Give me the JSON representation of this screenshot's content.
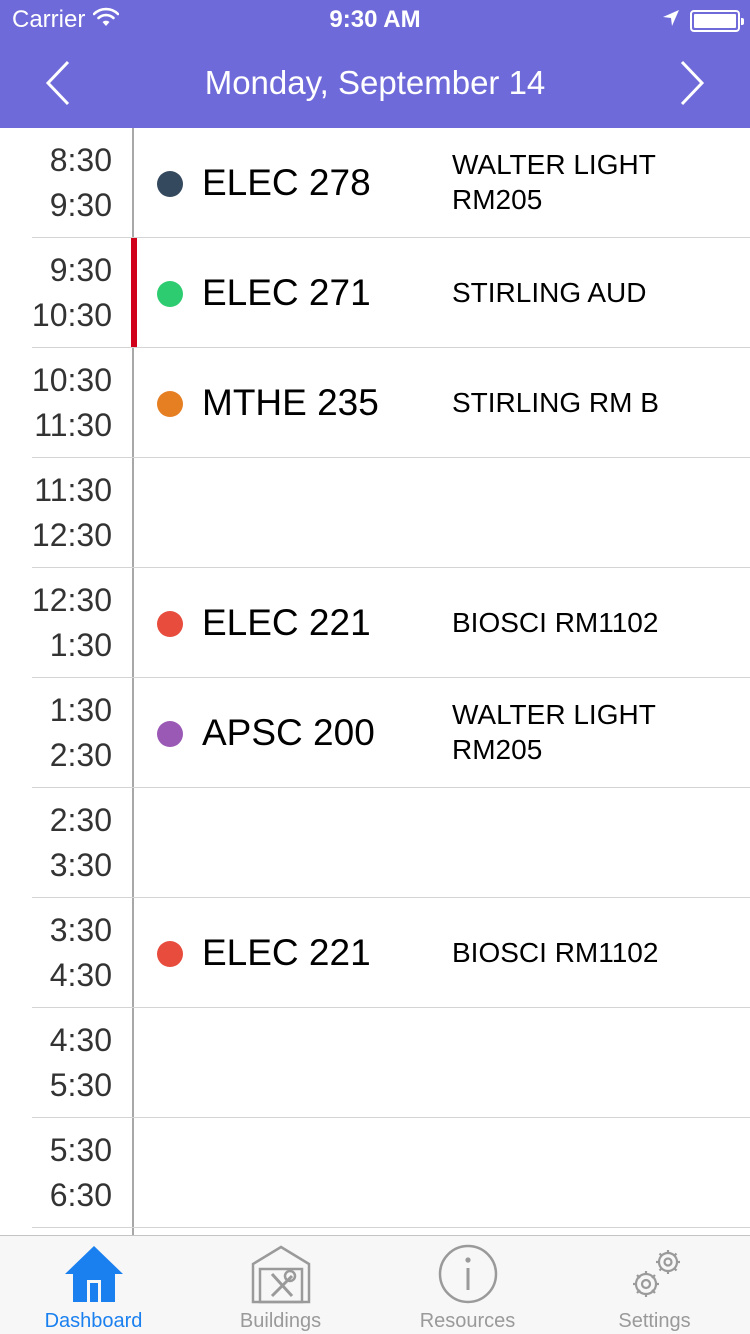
{
  "status_bar": {
    "carrier": "Carrier",
    "time": "9:30 AM"
  },
  "nav": {
    "title": "Monday, September 14",
    "prev_icon": "chevron-left-icon",
    "next_icon": "chevron-right-icon"
  },
  "schedule": {
    "current_slot": 1,
    "slots": [
      {
        "start": "8:30",
        "end": "9:30",
        "course": "ELEC 278",
        "room": "WALTER LIGHT RM205",
        "color": "#34495e"
      },
      {
        "start": "9:30",
        "end": "10:30",
        "course": "ELEC 271",
        "room": "STIRLING AUD",
        "color": "#2ecc71"
      },
      {
        "start": "10:30",
        "end": "11:30",
        "course": "MTHE 235",
        "room": "STIRLING RM B",
        "color": "#e67e22"
      },
      {
        "start": "11:30",
        "end": "12:30",
        "course": "",
        "room": "",
        "color": ""
      },
      {
        "start": "12:30",
        "end": "1:30",
        "course": "ELEC 221",
        "room": "BIOSCI RM1102",
        "color": "#e74c3c"
      },
      {
        "start": "1:30",
        "end": "2:30",
        "course": "APSC 200",
        "room": "WALTER LIGHT RM205",
        "color": "#9b59b6"
      },
      {
        "start": "2:30",
        "end": "3:30",
        "course": "",
        "room": "",
        "color": ""
      },
      {
        "start": "3:30",
        "end": "4:30",
        "course": "ELEC 221",
        "room": "BIOSCI RM1102",
        "color": "#e74c3c"
      },
      {
        "start": "4:30",
        "end": "5:30",
        "course": "",
        "room": "",
        "color": ""
      },
      {
        "start": "5:30",
        "end": "6:30",
        "course": "",
        "room": "",
        "color": ""
      }
    ]
  },
  "tabs": [
    {
      "label": "Dashboard",
      "icon": "home-icon",
      "active": true
    },
    {
      "label": "Buildings",
      "icon": "building-icon",
      "active": false
    },
    {
      "label": "Resources",
      "icon": "info-icon",
      "active": false
    },
    {
      "label": "Settings",
      "icon": "gears-icon",
      "active": false
    }
  ],
  "colors": {
    "header": "#6f6ad9",
    "current_indicator": "#d0021b",
    "active_tab": "#1a80ef",
    "inactive_tab": "#9a9a9a"
  }
}
